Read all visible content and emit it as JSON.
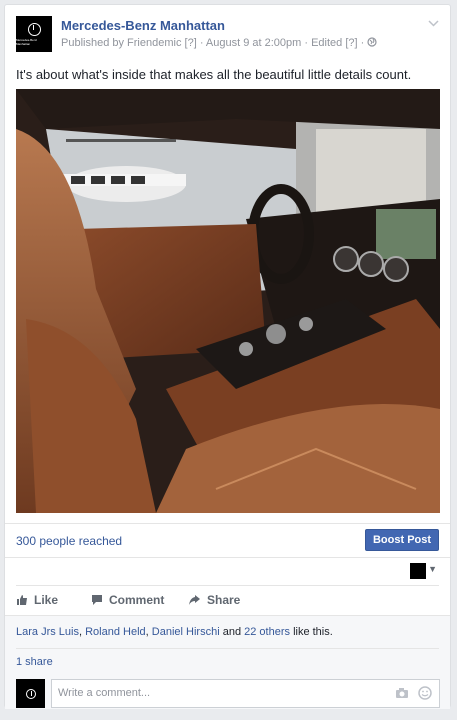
{
  "post": {
    "page_name": "Mercedes-Benz Manhattan",
    "published_by": "Published by Friendemic",
    "tag1": "[?]",
    "date": "· August 9 at 2:00pm · Edited",
    "tag2": "[?]",
    "dot": "·",
    "text": "It's about what's inside that makes all the beautiful little details count.",
    "avatar_text": "Mercedes-Benz Manhattan"
  },
  "insights": {
    "reach": "300 people reached",
    "boost_label": "Boost Post"
  },
  "actions": {
    "like": "Like",
    "comment": "Comment",
    "share": "Share"
  },
  "likes": {
    "user1": "Lara Jrs Luis",
    "sep1": ",",
    "user2": "Roland Held",
    "sep2": ",",
    "user3": "Daniel Hirschi",
    "and": "and",
    "others": "22 others",
    "suffix": "like this."
  },
  "shares": "1 share",
  "comment": {
    "placeholder": "Write a comment..."
  },
  "colors": {
    "link": "#365899",
    "boost": "#4267b2",
    "background": "#e9ebee"
  }
}
